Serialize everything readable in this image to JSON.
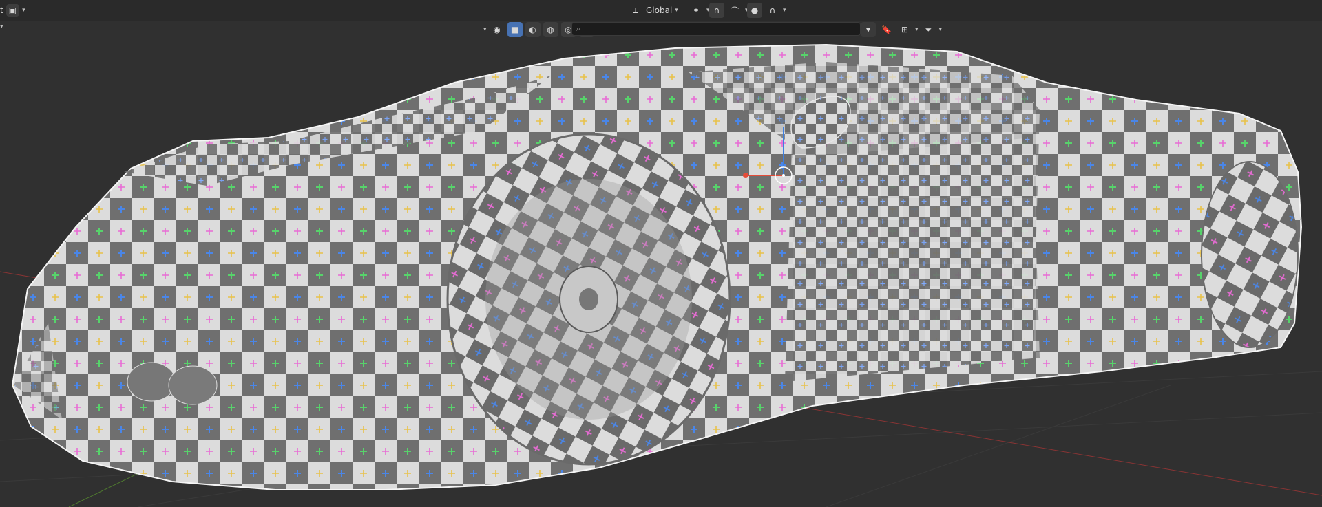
{
  "header": {
    "left_text": "t",
    "transform_orientation": "Global",
    "search_placeholder": ""
  },
  "icons": {
    "orientation": "transform-orientation-icon",
    "pivot": "pivot-point-icon",
    "snap": "snap-magnet-icon",
    "proportional": "proportional-editing-icon",
    "falloff": "falloff-curve-icon",
    "search": "search-icon",
    "bookmark": "bookmark-icon",
    "filter": "filter-icon"
  },
  "colors": {
    "viewport_bg": "#303030",
    "accent": "#4772b3",
    "gizmo_x": "#e44d3a",
    "gizmo_z": "#3d7fe0"
  }
}
